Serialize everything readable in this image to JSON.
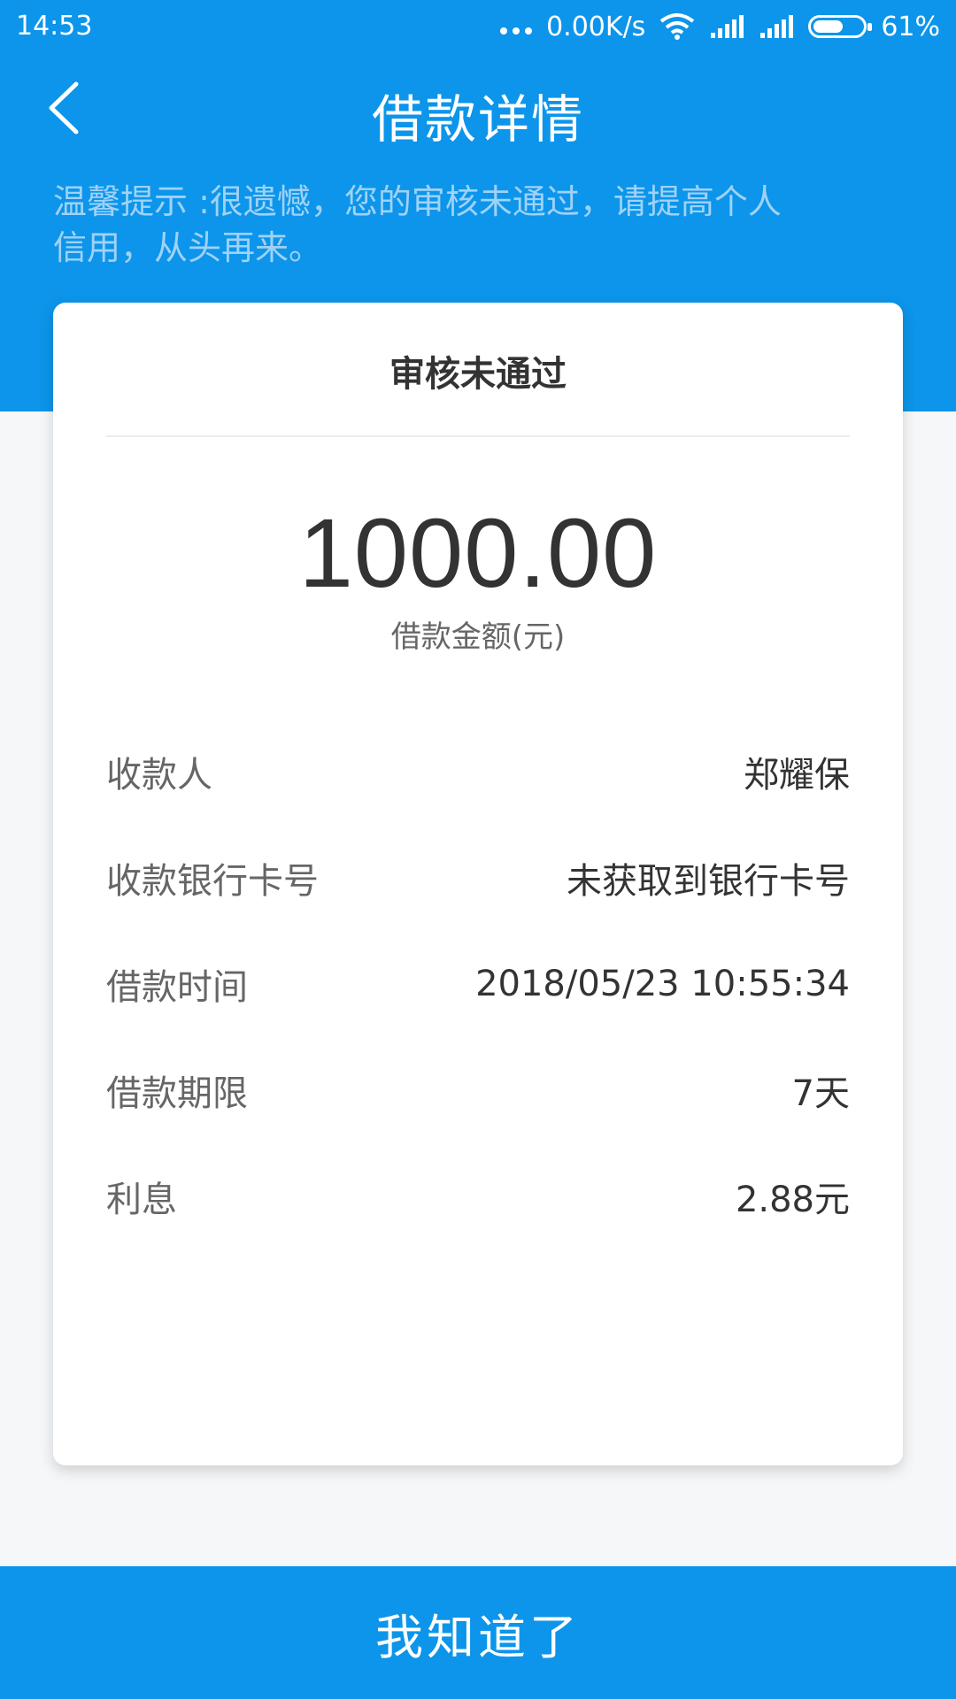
{
  "status_bar": {
    "time": "14:53",
    "network_speed": "0.00K/s",
    "battery_percent": "61%",
    "battery_level": 0.61,
    "icons": [
      "more-dots-icon",
      "wifi-icon",
      "signal-icon",
      "signal-icon",
      "battery-icon"
    ]
  },
  "nav": {
    "title": "借款详情",
    "back_icon": "chevron-left-icon"
  },
  "notice": {
    "text": "温馨提示 :很遗憾，您的审核未通过，请提高个人信用，从头再来。"
  },
  "card": {
    "status": "审核未通过",
    "amount": "1000.00",
    "amount_label": "借款金额(元)",
    "rows": [
      {
        "label": "收款人",
        "value": "郑耀保"
      },
      {
        "label": "收款银行卡号",
        "value": "未获取到银行卡号"
      },
      {
        "label": "借款时间",
        "value": "2018/05/23 10:55:34"
      },
      {
        "label": "借款期限",
        "value": "7天"
      },
      {
        "label": "利息",
        "value": "2.88元"
      }
    ]
  },
  "bottom_button": {
    "label": "我知道了"
  },
  "colors": {
    "primary": "#0c95ea",
    "background": "#f6f7f9",
    "card": "#ffffff",
    "text_dark": "#333333",
    "text_gray": "#666666",
    "notice_text": "#9fd2f7"
  }
}
